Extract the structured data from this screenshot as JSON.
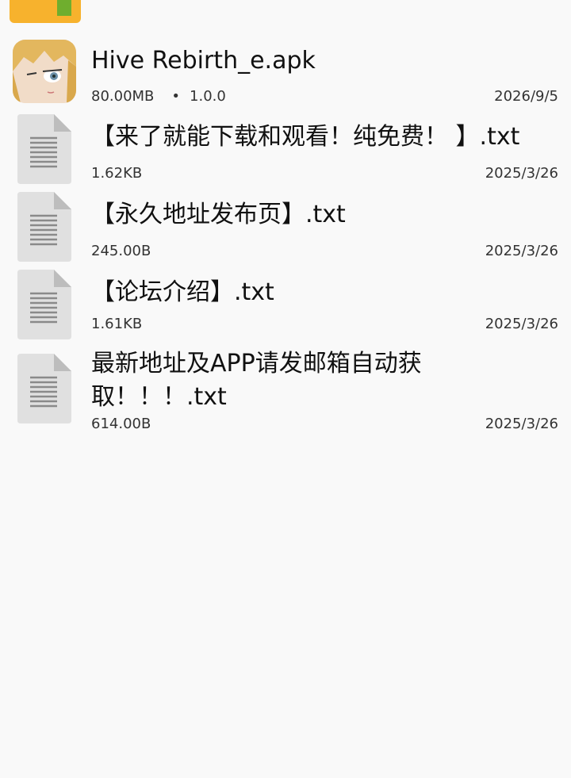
{
  "files": [
    {
      "name": "Hive Rebirth_e.apk",
      "size": "80.00MB",
      "separator": "•",
      "version": "1.0.0",
      "date": "2026/9/5",
      "icon": "app-icon"
    },
    {
      "name": "【来了就能下载和观看！纯免费！ 】.txt",
      "size": "1.62KB",
      "date": "2025/3/26",
      "icon": "text-file-icon"
    },
    {
      "name": "【永久地址发布页】.txt",
      "size": "245.00B",
      "date": "2025/3/26",
      "icon": "text-file-icon"
    },
    {
      "name": "【论坛介绍】.txt",
      "size": "1.61KB",
      "date": "2025/3/26",
      "icon": "text-file-icon"
    },
    {
      "name": "最新地址及APP请发邮箱自动获取！！！.txt",
      "size": "614.00B",
      "date": "2025/3/26",
      "icon": "text-file-icon"
    }
  ],
  "colors": {
    "folder": "#f7b22d",
    "folder_tab": "#6fae2e",
    "doc_icon": "#e0e0e0",
    "background": "#f9f9f9"
  }
}
